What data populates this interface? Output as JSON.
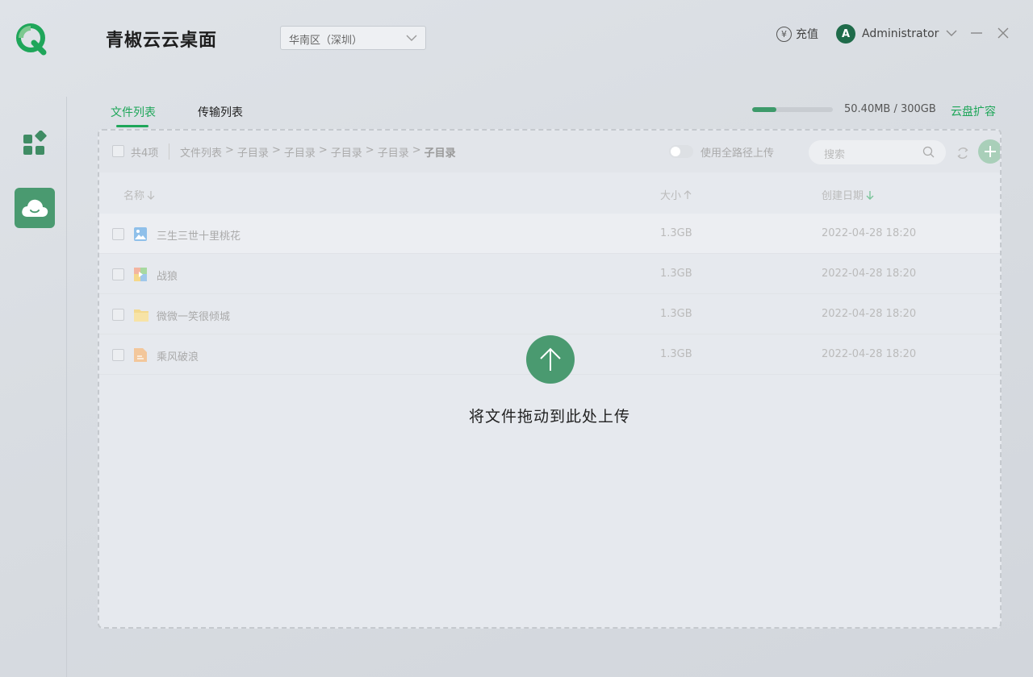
{
  "app": {
    "title": "青椒云云桌面",
    "region": "华南区（深圳）",
    "recharge_label": "充值",
    "user_initial": "A",
    "user_name": "Administrator"
  },
  "colors": {
    "brand_green": "#1fa65a",
    "accent": "#4a9a70",
    "avatar_bg": "#1f6b4a"
  },
  "tabs": [
    {
      "label": "文件列表",
      "active": true
    },
    {
      "label": "传输列表",
      "active": false
    }
  ],
  "storage": {
    "used_fraction": 0.3,
    "text": "50.40MB / 300GB",
    "expand_label": "云盘扩容"
  },
  "toolbar": {
    "count": "共4项",
    "breadcrumb": [
      "文件列表",
      ">",
      "子目录",
      ">",
      "子目录",
      ">",
      "子目录",
      ">",
      "子目录",
      ">",
      "子目录"
    ],
    "full_path_label": "使用全路径上传",
    "search_placeholder": "搜索"
  },
  "table": {
    "headers": {
      "name": "名称",
      "size": "大小",
      "date": "创建日期"
    },
    "rows": [
      {
        "icon": "image-file-icon",
        "name": "三生三世十里桃花",
        "size": "1.3GB",
        "date": "2022-04-28 18:20"
      },
      {
        "icon": "video-file-icon",
        "name": "战狼",
        "size": "1.3GB",
        "date": "2022-04-28 18:20"
      },
      {
        "icon": "folder-icon",
        "name": "微微一笑很倾城",
        "size": "1.3GB",
        "date": "2022-04-28 18:20"
      },
      {
        "icon": "document-file-icon",
        "name": "乘风破浪",
        "size": "1.3GB",
        "date": "2022-04-28 18:20"
      }
    ]
  },
  "upload": {
    "text": "将文件拖动到此处上传"
  }
}
